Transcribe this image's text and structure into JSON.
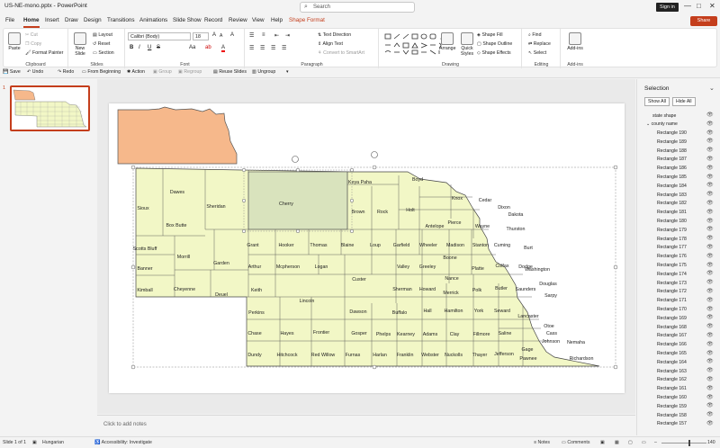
{
  "titlebar": {
    "doc_title": "US-NE-mono.pptx  -  PowerPoint",
    "search": "Search",
    "sign_in": "Sign in",
    "min": "—",
    "max": "□",
    "close": "✕"
  },
  "menu": {
    "tabs": [
      "File",
      "Home",
      "Insert",
      "Draw",
      "Design",
      "Transitions",
      "Animations",
      "Slide Show",
      "Record",
      "Review",
      "View",
      "Help"
    ],
    "shape_format": "Shape Format",
    "share": "Share"
  },
  "ribbon": {
    "clipboard": {
      "paste": "Paste",
      "cut": "Cut",
      "copy": "Copy",
      "format_painter": "Format Painter",
      "label": "Clipboard"
    },
    "slides": {
      "new_slide": "New Slide",
      "layout": "Layout",
      "reset": "Reset",
      "section": "Section",
      "label": "Slides"
    },
    "font": {
      "name": "Calibri (Body)",
      "size": "18",
      "label": "Font",
      "bold": "B",
      "italic": "I",
      "underline": "U",
      "strike": "S",
      "grow": "A",
      "shrink": "A",
      "clear": "A",
      "color": "A",
      "highlight": "ab",
      "aa": "Aa"
    },
    "paragraph": {
      "text_direction": "Text Direction",
      "align_text": "Align Text",
      "smartart": "Convert to SmartArt",
      "label": "Paragraph"
    },
    "drawing": {
      "arrange": "Arrange",
      "quick_styles": "Quick Styles",
      "fill": "Shape Fill",
      "outline": "Shape Outline",
      "effects": "Shape Effects",
      "label": "Drawing"
    },
    "editing": {
      "find": "Find",
      "replace": "Replace",
      "select": "Select",
      "label": "Editing"
    },
    "addins": {
      "addins": "Add-ins",
      "label": "Add-ins"
    }
  },
  "qat": {
    "save": "Save",
    "undo": "Undo",
    "redo": "Redo",
    "from_beginning": "From Beginning",
    "action": "Action",
    "group": "Group",
    "regroup": "Regroup",
    "reuse": "Reuse Slides",
    "ungroup": "Ungroup"
  },
  "slide_panel": {
    "number": "1"
  },
  "map": {
    "counties": [
      "Sioux",
      "Dawes",
      "Sheridan",
      "Cherry",
      "Keya Paha",
      "Boyd",
      "Knox",
      "Cedar",
      "Dixon",
      "Dakota",
      "Box Butte",
      "Brown",
      "Rock",
      "Holt",
      "Antelope",
      "Pierce",
      "Wayne",
      "Thurston",
      "Scotts Bluff",
      "Morrill",
      "Grant",
      "Hooker",
      "Thomas",
      "Blaine",
      "Loup",
      "Garfield",
      "Wheeler",
      "Madison",
      "Stanton",
      "Cuming",
      "Burt",
      "Banner",
      "Garden",
      "Arthur",
      "Mcpherson",
      "Logan",
      "Custer",
      "Valley",
      "Greeley",
      "Boone",
      "Platte",
      "Colfax",
      "Dodge",
      "Washington",
      "Kimball",
      "Cheyenne",
      "Deuel",
      "Keith",
      "Lincoln",
      "Sherman",
      "Howard",
      "Merrick",
      "Nance",
      "Polk",
      "Butler",
      "Saunders",
      "Douglas",
      "Sarpy",
      "Perkins",
      "Dawson",
      "Buffalo",
      "Hall",
      "Hamilton",
      "York",
      "Seward",
      "Lancaster",
      "Cass",
      "Otoe",
      "Chase",
      "Hayes",
      "Frontier",
      "Gosper",
      "Phelps",
      "Kearney",
      "Adams",
      "Clay",
      "Fillmore",
      "Saline",
      "Gage",
      "Johnson",
      "Nemaha",
      "Dundy",
      "Hitchcock",
      "Red Willow",
      "Furnas",
      "Harlan",
      "Franklin",
      "Webster",
      "Nuckolls",
      "Thayer",
      "Jefferson",
      "Pawnee",
      "Richardson"
    ]
  },
  "notes": {
    "placeholder": "Click to add notes"
  },
  "selection": {
    "title": "Selection",
    "show_all": "Show All",
    "hide_all": "Hide All",
    "items": [
      "state shape",
      "county name",
      "Rectangle 190",
      "Rectangle 189",
      "Rectangle 188",
      "Rectangle 187",
      "Rectangle 186",
      "Rectangle 185",
      "Rectangle 184",
      "Rectangle 183",
      "Rectangle 182",
      "Rectangle 181",
      "Rectangle 180",
      "Rectangle 179",
      "Rectangle 178",
      "Rectangle 177",
      "Rectangle 176",
      "Rectangle 175",
      "Rectangle 174",
      "Rectangle 173",
      "Rectangle 172",
      "Rectangle 171",
      "Rectangle 170",
      "Rectangle 169",
      "Rectangle 168",
      "Rectangle 167",
      "Rectangle 166",
      "Rectangle 165",
      "Rectangle 164",
      "Rectangle 163",
      "Rectangle 162",
      "Rectangle 161",
      "Rectangle 160",
      "Rectangle 159",
      "Rectangle 158",
      "Rectangle 157"
    ]
  },
  "status": {
    "slide": "Slide 1 of 1",
    "language": "Hungarian",
    "accessibility": "Accessibility: Investigate",
    "notes": "Notes",
    "comments": "Comments",
    "zoom": "140"
  },
  "colors": {
    "accent": "#c43e1c",
    "county_fill": "#f2f7c6",
    "selected_fill": "#d9e3bd",
    "state_fill": "#f6b88b"
  }
}
